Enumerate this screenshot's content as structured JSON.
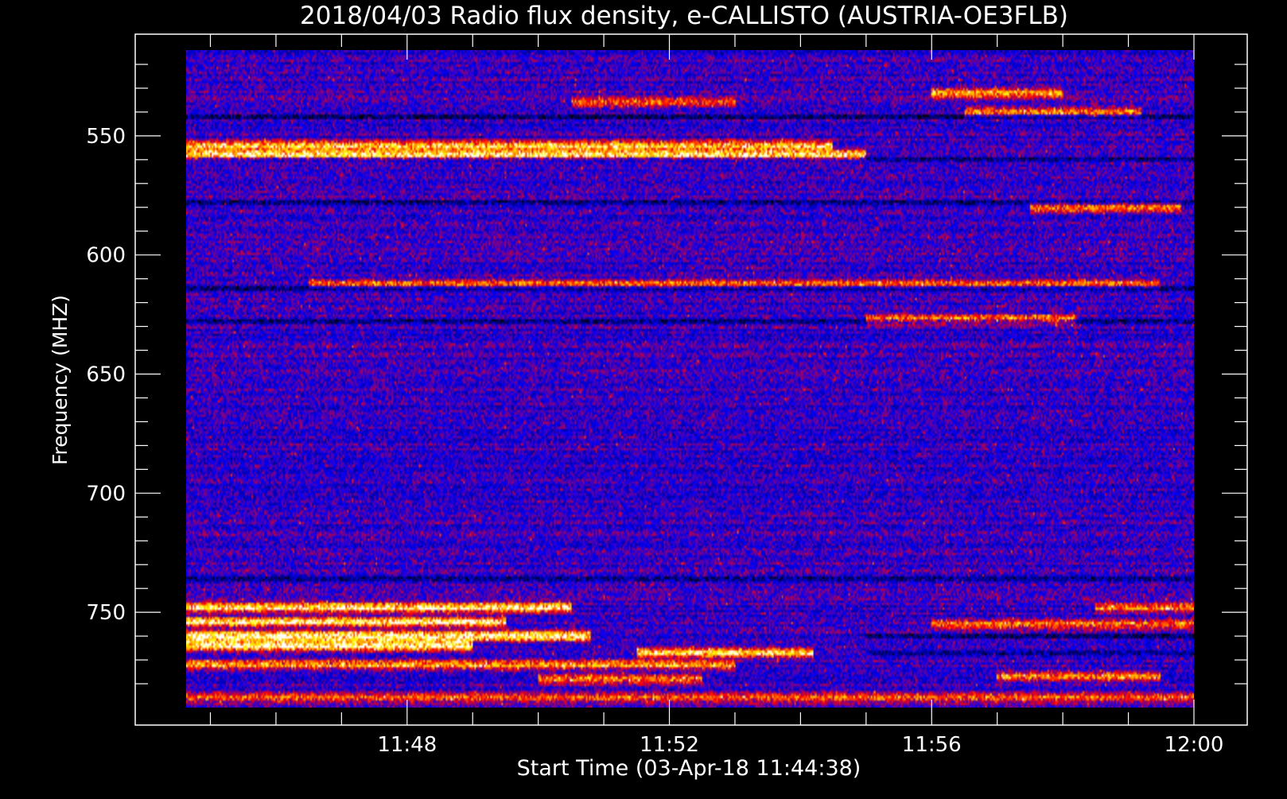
{
  "chart_data": {
    "type": "heatmap",
    "title": "2018/04/03  Radio flux density, e-CALLISTO (AUSTRIA-OE3FLB)",
    "xlabel": "Start Time (03-Apr-18 11:44:38)",
    "ylabel": "Frequency (MHZ)",
    "x_ticks": [
      "11:48",
      "11:52",
      "11:56",
      "12:00"
    ],
    "x_tick_minutes": [
      48,
      52,
      56,
      60
    ],
    "y_ticks": [
      550,
      600,
      650,
      700,
      750
    ],
    "x_range_minutes": [
      44.63,
      60.0
    ],
    "y_range_mhz": [
      514,
      790
    ],
    "y_inverted": true,
    "colormap": [
      "#000000",
      "#0000ff",
      "#ff0000",
      "#ffa500",
      "#ffff00",
      "#ffffff"
    ],
    "background": "#000000",
    "foreground": "#ffffff",
    "bright_bands": [
      {
        "freq_mhz": 532,
        "t_start": 56.0,
        "t_end": 58.0,
        "intensity": 0.6
      },
      {
        "freq_mhz": 536,
        "t_start": 50.5,
        "t_end": 53.0,
        "intensity": 0.45
      },
      {
        "freq_mhz": 540,
        "t_start": 56.5,
        "t_end": 59.2,
        "intensity": 0.55
      },
      {
        "freq_mhz": 554,
        "t_start": 44.63,
        "t_end": 54.5,
        "intensity": 0.7
      },
      {
        "freq_mhz": 558,
        "t_start": 44.63,
        "t_end": 55.0,
        "intensity": 0.8
      },
      {
        "freq_mhz": 580,
        "t_start": 57.5,
        "t_end": 59.8,
        "intensity": 0.55
      },
      {
        "freq_mhz": 612,
        "t_start": 46.5,
        "t_end": 59.5,
        "intensity": 0.45
      },
      {
        "freq_mhz": 627,
        "t_start": 55.0,
        "t_end": 58.2,
        "intensity": 0.6
      },
      {
        "freq_mhz": 748,
        "t_start": 44.63,
        "t_end": 50.5,
        "intensity": 0.85
      },
      {
        "freq_mhz": 754,
        "t_start": 44.63,
        "t_end": 49.5,
        "intensity": 0.85
      },
      {
        "freq_mhz": 760,
        "t_start": 44.63,
        "t_end": 50.8,
        "intensity": 0.95
      },
      {
        "freq_mhz": 764,
        "t_start": 44.63,
        "t_end": 49.0,
        "intensity": 0.9
      },
      {
        "freq_mhz": 767,
        "t_start": 51.5,
        "t_end": 54.2,
        "intensity": 0.75
      },
      {
        "freq_mhz": 772,
        "t_start": 44.63,
        "t_end": 53.0,
        "intensity": 0.6
      },
      {
        "freq_mhz": 778,
        "t_start": 50.0,
        "t_end": 52.5,
        "intensity": 0.6
      },
      {
        "freq_mhz": 777,
        "t_start": 57.0,
        "t_end": 59.5,
        "intensity": 0.6
      },
      {
        "freq_mhz": 786,
        "t_start": 44.63,
        "t_end": 60.0,
        "intensity": 0.45
      },
      {
        "freq_mhz": 748,
        "t_start": 58.5,
        "t_end": 60.0,
        "intensity": 0.55
      },
      {
        "freq_mhz": 755,
        "t_start": 56.0,
        "t_end": 60.0,
        "intensity": 0.5
      }
    ],
    "dark_bands": [
      {
        "freq_mhz": 542,
        "t_start": 44.63,
        "t_end": 60.0
      },
      {
        "freq_mhz": 560,
        "t_start": 44.63,
        "t_end": 60.0
      },
      {
        "freq_mhz": 578,
        "t_start": 44.63,
        "t_end": 60.0
      },
      {
        "freq_mhz": 614,
        "t_start": 44.63,
        "t_end": 60.0
      },
      {
        "freq_mhz": 628,
        "t_start": 44.63,
        "t_end": 60.0
      },
      {
        "freq_mhz": 736,
        "t_start": 44.63,
        "t_end": 60.0
      },
      {
        "freq_mhz": 760,
        "t_start": 55.0,
        "t_end": 60.0
      },
      {
        "freq_mhz": 767,
        "t_start": 55.0,
        "t_end": 60.0
      }
    ]
  }
}
